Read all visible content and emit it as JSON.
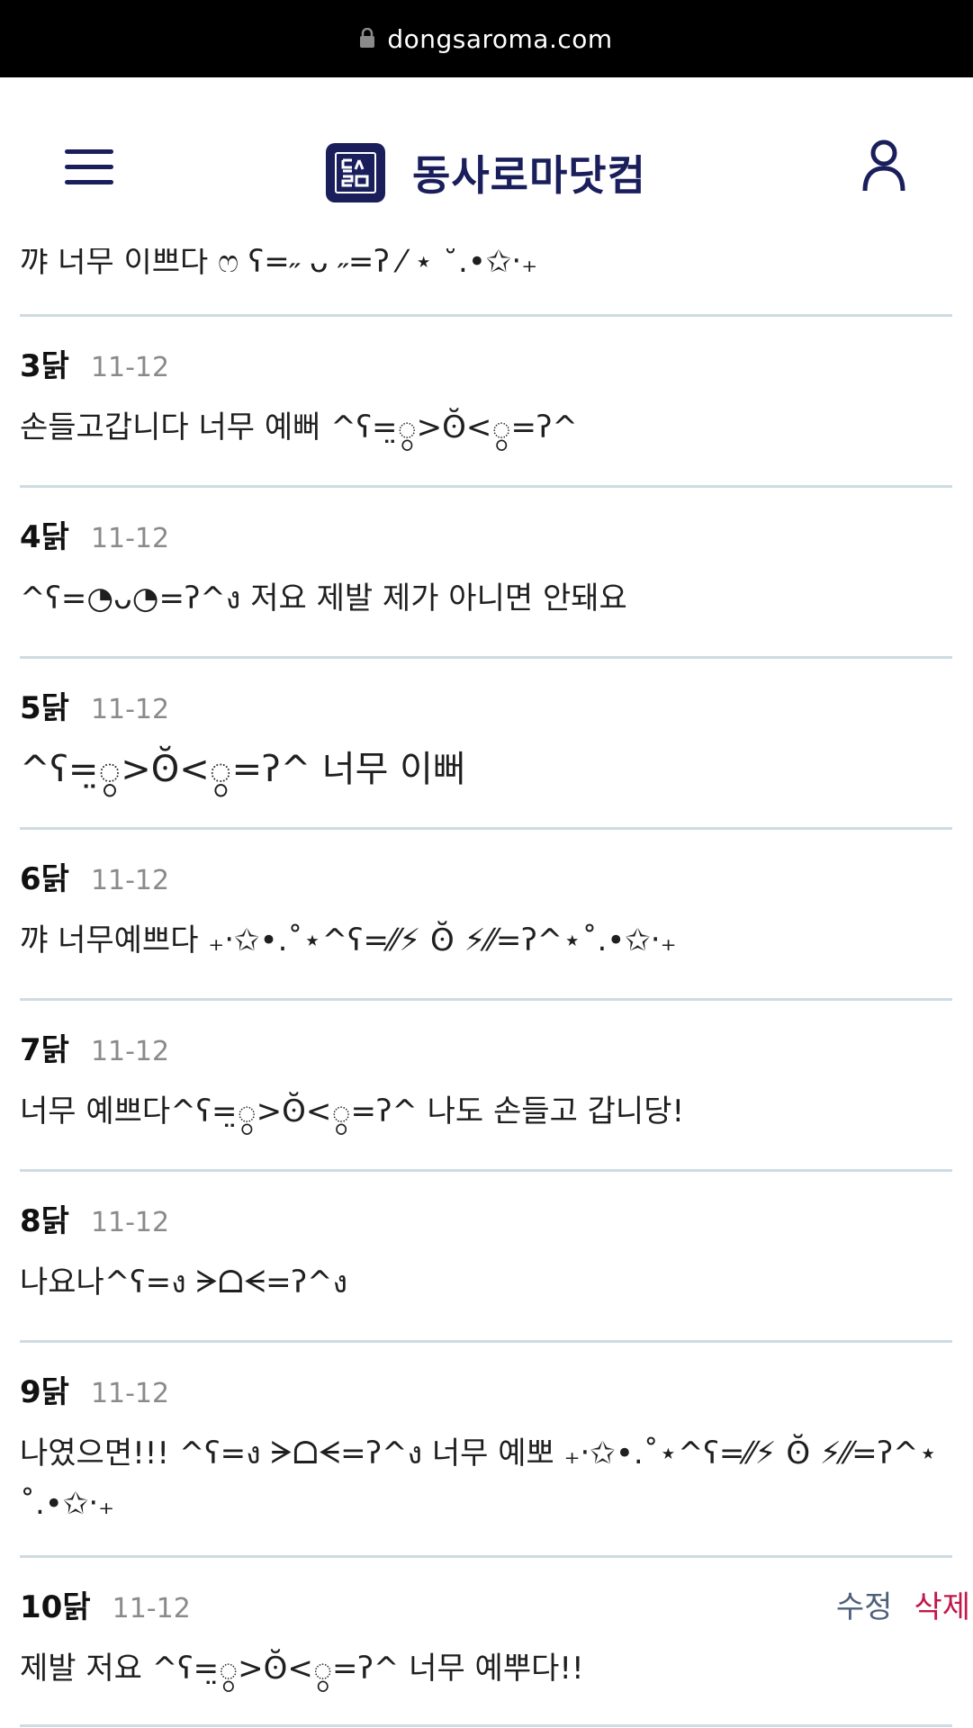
{
  "browser": {
    "url": "dongsaroma.com"
  },
  "header": {
    "site_title": "동사로마닷컴",
    "logo_text": "동사\n로마"
  },
  "partial_comment": {
    "text": "꺄 너무 이쁘다 ෆ ʕ=˶ ᴗ ˶=ʔ ⁄ ⋆ ˚.•✩‧₊"
  },
  "comments": [
    {
      "nick": "3닭",
      "date": "11-12",
      "text": "손들고갑니다 너무 예뻐 ^ʕ=̤ွ>ʘ̆<ွ=ʔ^"
    },
    {
      "nick": "4닭",
      "date": "11-12",
      "text": "^ʕ=◔ᴗ◔=ʔ^ง 저요 제발 제가 아니면 안돼요"
    },
    {
      "nick": "5닭",
      "date": "11-12",
      "text": "^ʕ=̤ွ>ʘ̆<ွ=ʔ^ 너무 이뻐"
    },
    {
      "nick": "6닭",
      "date": "11-12",
      "text": "꺄 너무예쁘다 ₊‧✩•.˚⋆^ʕ=⁄⁄⚡ ʘ̆ ⚡⁄⁄=ʔ^⋆˚.•✩‧₊"
    },
    {
      "nick": "7닭",
      "date": "11-12",
      "text": "너무 예쁘다^ʕ=̤ွ>ʘ̆<ွ=ʔ^ 나도 손들고 갑니당!"
    },
    {
      "nick": "8닭",
      "date": "11-12",
      "text": "나요나^ʕ=ง ᗒᗝᗕ=ʔ^ง"
    },
    {
      "nick": "9닭",
      "date": "11-12",
      "text": "나였으면!!! ^ʕ=ง ᗒᗝᗕ=ʔ^ง 너무 예뽀 ₊‧✩•.˚⋆^ʕ=⁄⁄⚡ ʘ̆ ⚡⁄⁄=ʔ^⋆˚.•✩‧₊"
    },
    {
      "nick": "10닭",
      "date": "11-12",
      "text": "제발 저요 ^ʕ=̤ွ>ʘ̆<ွ=ʔ^ 너무 예뿌다!!",
      "edit_label": "수정",
      "delete_label": "삭제"
    }
  ],
  "icons": {
    "menu": "hamburger-icon",
    "user": "user-icon",
    "lock": "lock-icon"
  },
  "colors": {
    "brand": "#1a1f5c",
    "delete": "#c2184b",
    "edit": "#50607a",
    "divider": "#cfdbe3"
  }
}
